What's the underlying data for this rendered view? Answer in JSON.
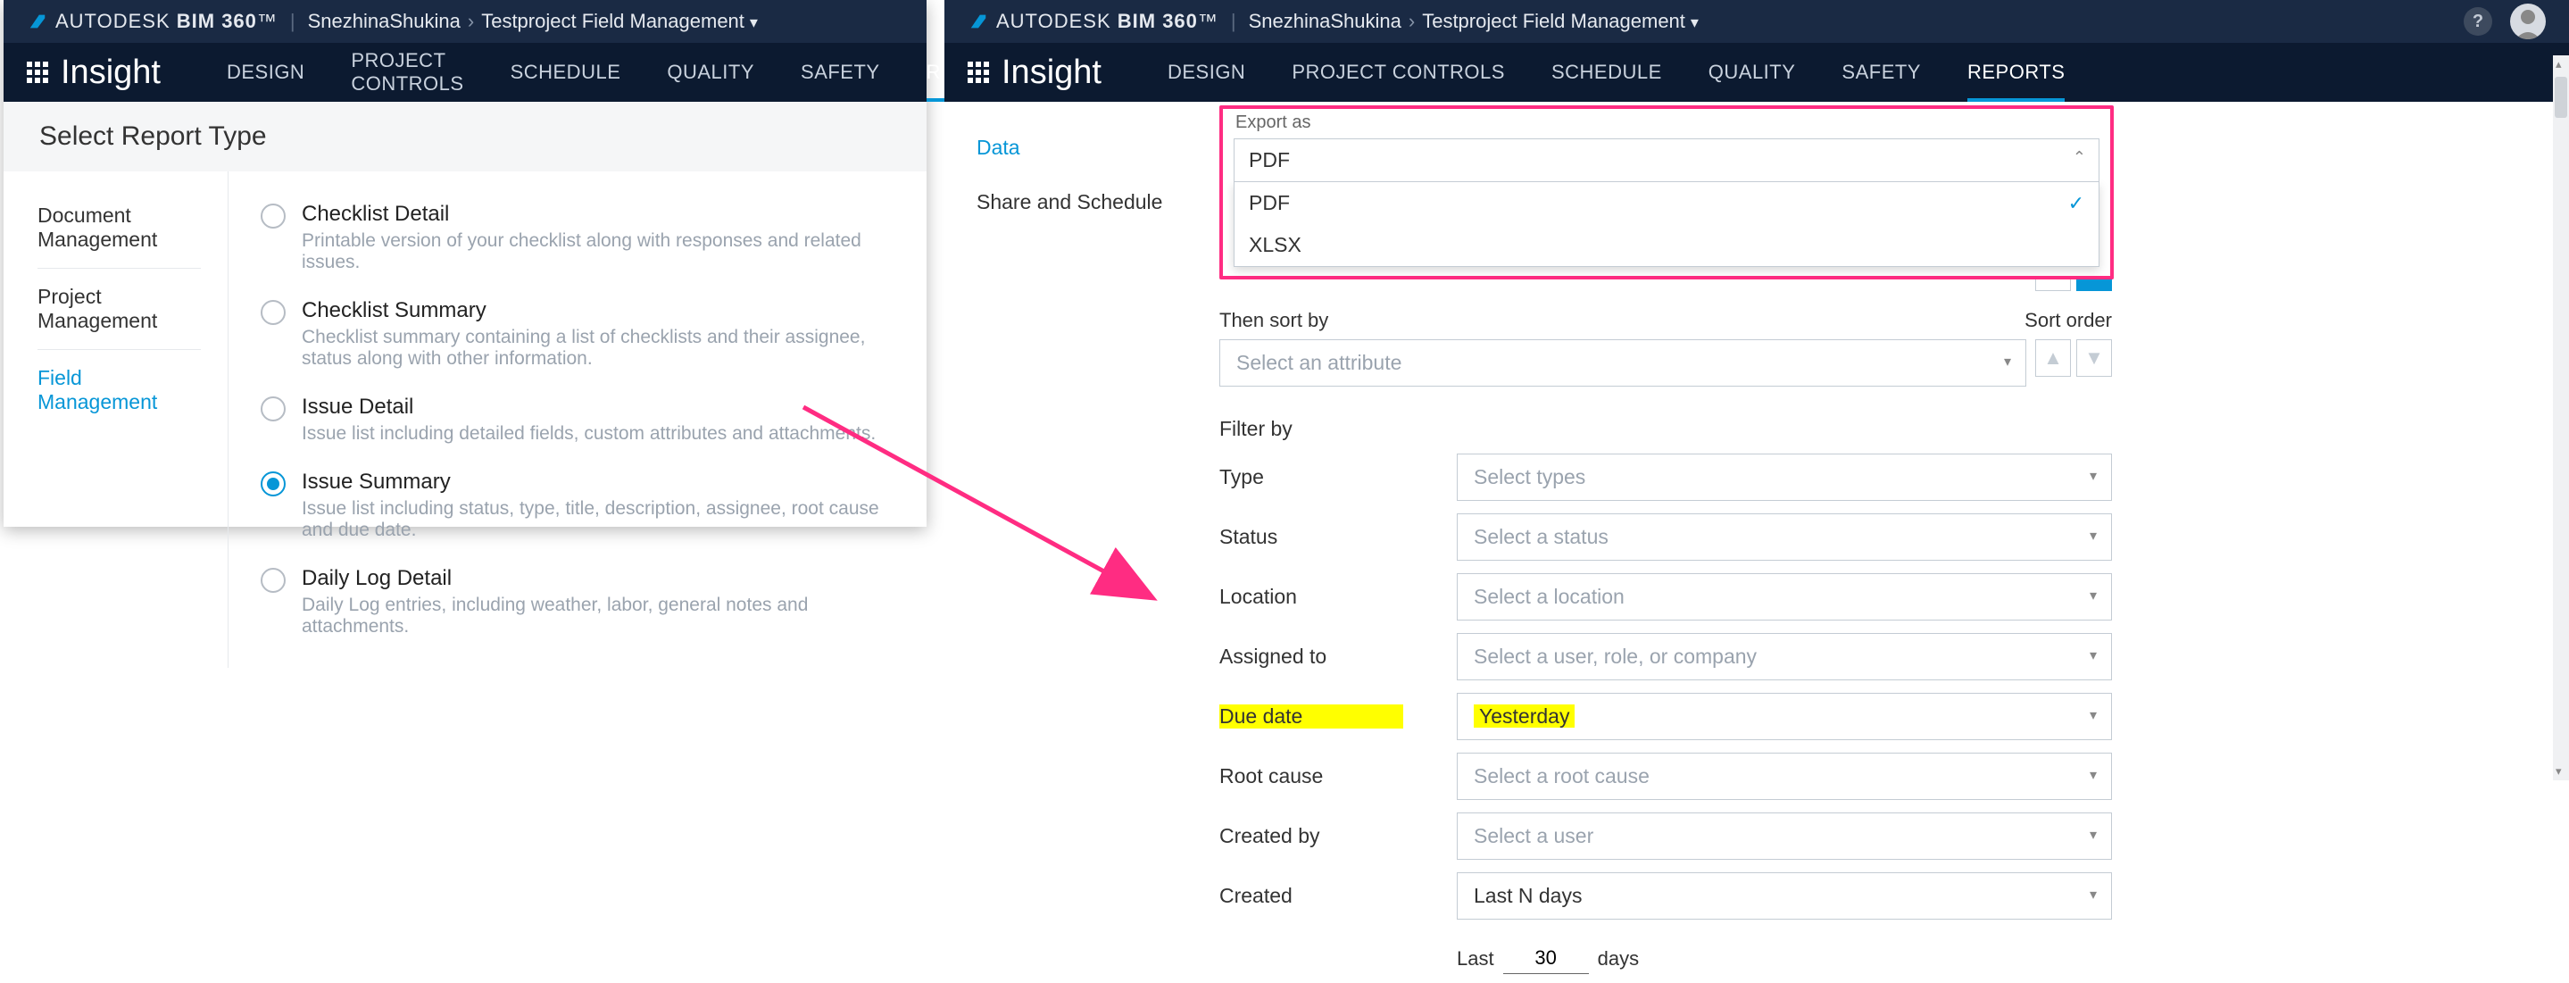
{
  "brand": {
    "prefix": "AUTODESK",
    "name": "BIM 360",
    "tm": "™"
  },
  "breadcrumb": {
    "user": "SnezhinaShukina",
    "project": "Testproject Field Management"
  },
  "module": "Insight",
  "nav": [
    "DESIGN",
    "PROJECT CONTROLS",
    "SCHEDULE",
    "QUALITY",
    "SAFETY",
    "REPORTS"
  ],
  "panel1": {
    "title": "Select Report Type",
    "sidebar": [
      "Document Management",
      "Project Management",
      "Field Management"
    ],
    "active_sidebar_index": 2,
    "options": [
      {
        "title": "Checklist Detail",
        "desc": "Printable version of your checklist along with responses and related issues."
      },
      {
        "title": "Checklist Summary",
        "desc": "Checklist summary containing a list of checklists and their assignee, status along with other information."
      },
      {
        "title": "Issue Detail",
        "desc": "Issue list including detailed fields, custom attributes and attachments."
      },
      {
        "title": "Issue Summary",
        "desc": "Issue list including status, type, title, description, assignee, root cause and due date."
      },
      {
        "title": "Daily Log Detail",
        "desc": "Daily Log entries, including weather, labor, general notes and attachments."
      }
    ],
    "selected_option_index": 3
  },
  "panel2": {
    "sidebar": [
      "Data",
      "Share and Schedule"
    ],
    "active_sidebar_index": 0,
    "export": {
      "label": "Export as",
      "selected": "PDF",
      "options": [
        "PDF",
        "XLSX"
      ],
      "checked_index": 0
    },
    "then_sort": {
      "label": "Then sort by",
      "placeholder": "Select an attribute",
      "order_label": "Sort order"
    },
    "filter": {
      "title": "Filter by",
      "rows": [
        {
          "label": "Type",
          "placeholder": "Select types"
        },
        {
          "label": "Status",
          "placeholder": "Select a status"
        },
        {
          "label": "Location",
          "placeholder": "Select a location"
        },
        {
          "label": "Assigned to",
          "placeholder": "Select a user, role, or company"
        },
        {
          "label": "Due date",
          "placeholder": "Yesterday",
          "highlight": true
        },
        {
          "label": "Root cause",
          "placeholder": "Select a root cause"
        },
        {
          "label": "Created by",
          "placeholder": "Select a user"
        },
        {
          "label": "Created",
          "placeholder": "Last N days"
        }
      ],
      "last_n": {
        "prefix": "Last",
        "value": "30",
        "suffix": "days"
      }
    }
  }
}
